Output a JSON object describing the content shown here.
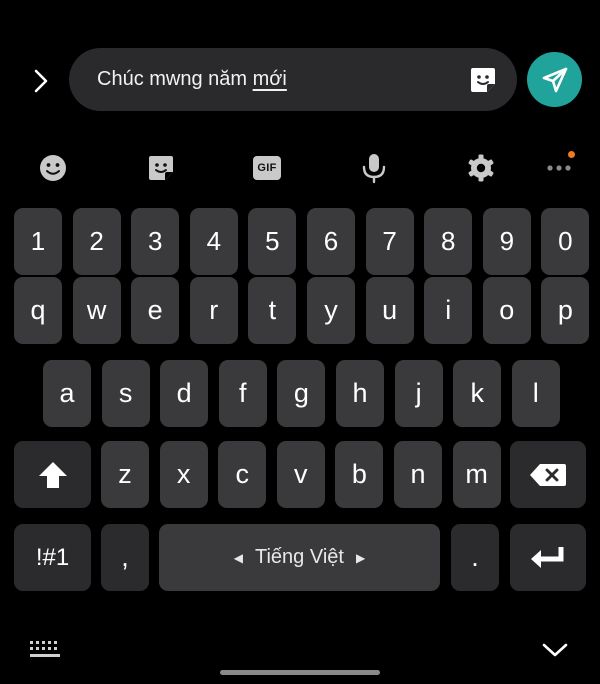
{
  "composer": {
    "message_plain": "Chúc mwng năm ",
    "message_underlined": "mới",
    "expand_icon": "chevron-right-icon",
    "sticker_icon": "sticker-icon",
    "send_icon": "send-icon",
    "accent_color": "#1fa39a"
  },
  "toolbar": {
    "items": [
      "emoji-icon",
      "sticker-icon",
      "gif-icon",
      "microphone-icon",
      "gear-icon",
      "more-icon"
    ],
    "gif_label": "GIF",
    "badge_color": "#f07a1e"
  },
  "keyboard": {
    "number_row": [
      "1",
      "2",
      "3",
      "4",
      "5",
      "6",
      "7",
      "8",
      "9",
      "0"
    ],
    "row1": [
      "q",
      "w",
      "e",
      "r",
      "t",
      "y",
      "u",
      "i",
      "o",
      "p"
    ],
    "row2": [
      "a",
      "s",
      "d",
      "f",
      "g",
      "h",
      "j",
      "k",
      "l"
    ],
    "row3": [
      "z",
      "x",
      "c",
      "v",
      "b",
      "n",
      "m"
    ],
    "symbols_label": "!#1",
    "comma_label": ",",
    "space_label": "Tiếng Việt",
    "period_label": ".",
    "key_color": "#3a3a3c",
    "function_key_color": "#2b2b2d"
  },
  "bottom": {
    "left_icon": "keyboard-icon",
    "right_icon": "chevron-down-icon"
  }
}
